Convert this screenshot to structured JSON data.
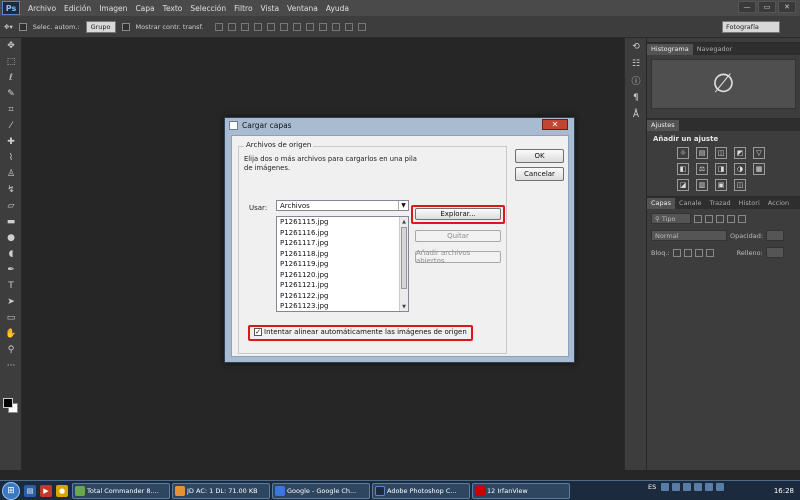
{
  "app": {
    "logo": "Ps"
  },
  "menu": [
    "Archivo",
    "Edición",
    "Imagen",
    "Capa",
    "Texto",
    "Selección",
    "Filtro",
    "Vista",
    "Ventana",
    "Ayuda"
  ],
  "window_controls": [
    "—",
    "▭",
    "✕"
  ],
  "options_bar": {
    "auto_select_label": "Selec. autom.:",
    "auto_select_target": "Grupo",
    "show_transform_label": "Mostrar contr. transf.",
    "workspace": "Fotografía"
  },
  "right_panels": {
    "top_tabs": [
      "Histograma",
      "Navegador"
    ],
    "histogram_symbol": "∅",
    "adjust_tab": "Ajustes",
    "adjust_title": "Añadir un ajuste",
    "adjust_icons": [
      "☼",
      "▤",
      "◫",
      "◩",
      "▽",
      "◧",
      "⚖",
      "◨",
      "◑",
      "▦",
      "◪",
      "▥",
      "▣",
      "◫"
    ],
    "layer_tabs": [
      "Capas",
      "Canale",
      "Trazad",
      "Histori",
      "Accion"
    ],
    "kind_label": "Tipo",
    "blend_mode": "Normal",
    "opacity_label": "Opacidad:",
    "lock_label": "Bloq.:",
    "fill_label": "Relleno:"
  },
  "dialog": {
    "title": "Cargar capas",
    "close_glyph": "✕",
    "group_legend": "Archivos de origen",
    "description": "Elija dos o más archivos para cargarlos en una pila de imágenes.",
    "use_label": "Usar:",
    "use_value": "Archivos",
    "files": [
      "P1261115.jpg",
      "P1261116.jpg",
      "P1261117.jpg",
      "P1261118.jpg",
      "P1261119.jpg",
      "P1261120.jpg",
      "P1261121.jpg",
      "P1261122.jpg",
      "P1261123.jpg"
    ],
    "browse_label": "Explorar...",
    "remove_label": "Quitar",
    "add_open_label": "Añadir archivos abiertos",
    "ok_label": "OK",
    "cancel_label": "Cancelar",
    "auto_align_label": "Intentar alinear automáticamente las imágenes de origen",
    "auto_align_checked": true,
    "highlight_color": "#e0151b"
  },
  "taskbar": {
    "start_glyph": "⊞",
    "tasks": [
      {
        "label": "Total Commander 8....",
        "color": "#6aa84f"
      },
      {
        "label": "JD AC: 1 DL: 71.00 KB",
        "color": "#e69138"
      },
      {
        "label": "Google - Google Ch...",
        "color": "#3c78d8"
      },
      {
        "label": "Adobe Photoshop C...",
        "color": "#1b2a40"
      },
      {
        "label": "12 IrfanView",
        "color": "#cc0000"
      }
    ],
    "language": "ES",
    "clock": "16:28"
  }
}
